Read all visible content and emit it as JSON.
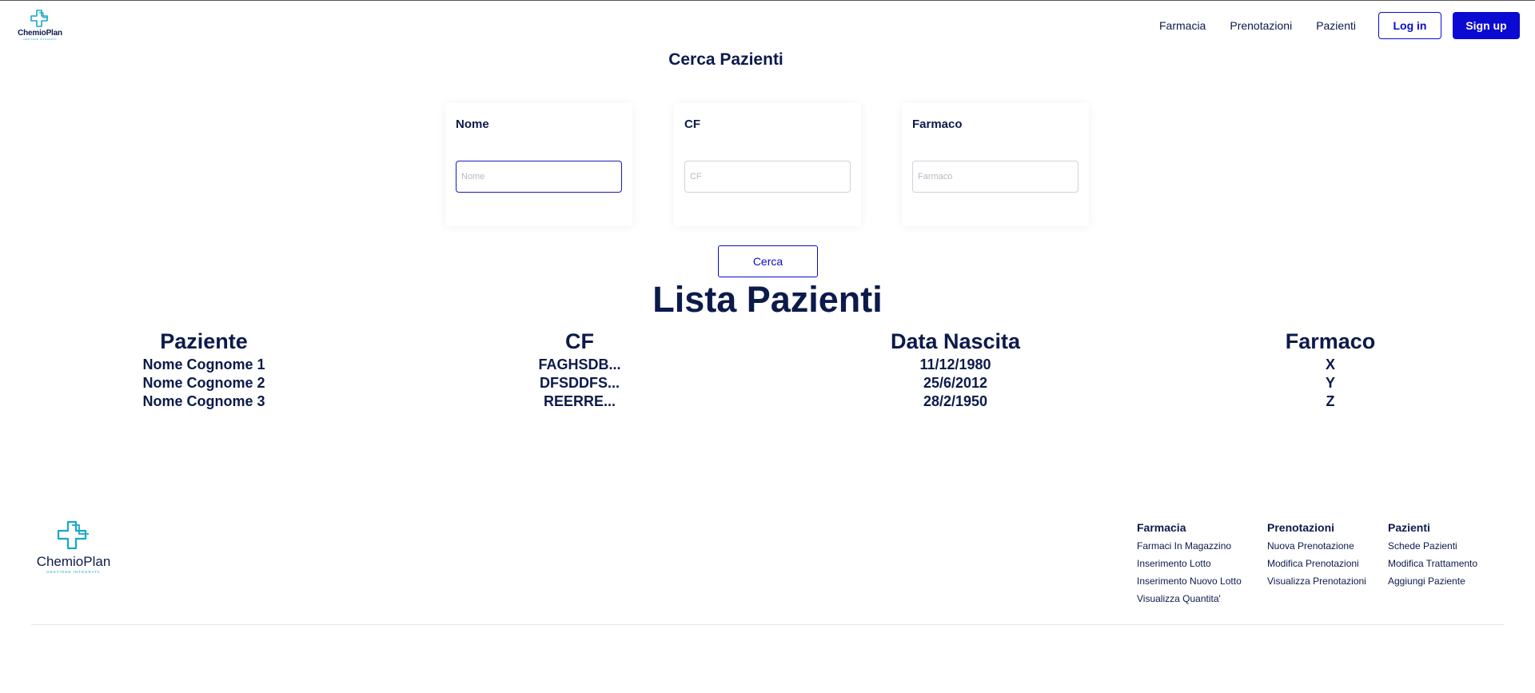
{
  "header": {
    "logo_text": "ChemioPlan",
    "logo_sub": "GESTIONE INTEGRATA",
    "nav": [
      "Farmacia",
      "Prenotazioni",
      "Pazienti"
    ],
    "login_label": "Log in",
    "signup_label": "Sign up"
  },
  "search": {
    "title": "Cerca Pazienti",
    "fields": [
      {
        "label": "Nome",
        "placeholder": "Nome"
      },
      {
        "label": "CF",
        "placeholder": "CF"
      },
      {
        "label": "Farmaco",
        "placeholder": "Farmaco"
      }
    ],
    "button_label": "Cerca"
  },
  "list": {
    "title": "Lista Pazienti",
    "columns": [
      "Paziente",
      "CF",
      "Data Nascita",
      "Farmaco"
    ],
    "rows": [
      [
        "Nome Cognome 1",
        "FAGHSDB...",
        "11/12/1980",
        "X"
      ],
      [
        "Nome Cognome 2",
        "DFSDDFS...",
        "25/6/2012",
        "Y"
      ],
      [
        "Nome Cognome 3",
        "REERRE...",
        "28/2/1950",
        "Z"
      ]
    ]
  },
  "footer": {
    "logo_text": "ChemioPlan",
    "logo_sub": "GESTIONE INTEGRATA",
    "columns": [
      {
        "title": "Farmacia",
        "links": [
          "Farmaci In Magazzino",
          "Inserimento Lotto",
          "Inserimento Nuovo Lotto",
          "Visualizza Quantita'"
        ]
      },
      {
        "title": "Prenotazioni",
        "links": [
          "Nuova Prenotazione",
          "Modifica Prenotazioni",
          "Visualizza Prenotazioni"
        ]
      },
      {
        "title": "Pazienti",
        "links": [
          "Schede Pazienti",
          "Modifica Trattamento",
          "Aggiungi Paziente"
        ]
      }
    ]
  },
  "colors": {
    "brand_navy": "#0c1a4b",
    "accent_blue": "#0a0ad2",
    "logo_teal": "#18a7c9"
  }
}
